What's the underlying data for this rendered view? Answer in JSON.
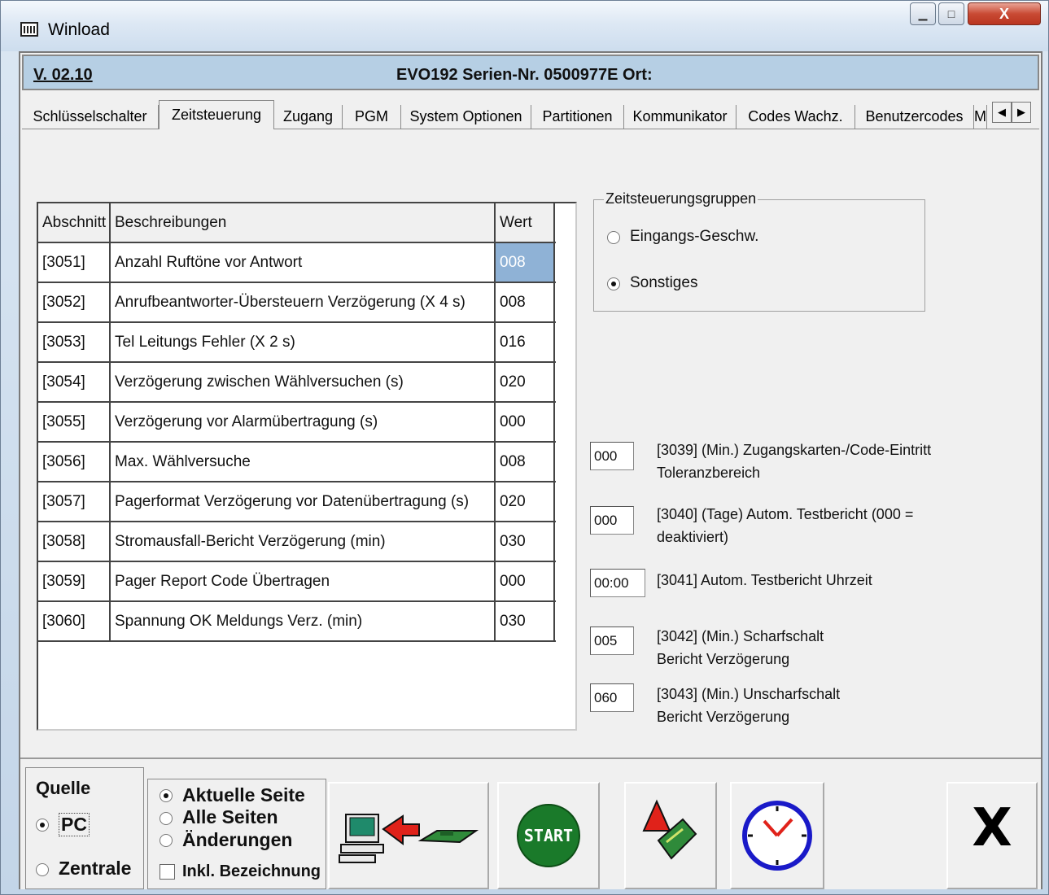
{
  "window": {
    "title": "Winload"
  },
  "header": {
    "version": "V. 02.10",
    "device": "EVO192  Serien-Nr. 0500977E Ort:"
  },
  "tabs": [
    {
      "label": "Schlüsselschalter"
    },
    {
      "label": "Zeitsteuerung"
    },
    {
      "label": "Zugang"
    },
    {
      "label": "PGM"
    },
    {
      "label": "System Optionen"
    },
    {
      "label": "Partitionen"
    },
    {
      "label": "Kommunikator"
    },
    {
      "label": "Codes Wachz."
    },
    {
      "label": "Benutzercodes"
    },
    {
      "label": "M"
    }
  ],
  "table": {
    "headers": [
      "Abschnitt",
      "Beschreibungen",
      "Wert"
    ],
    "rows": [
      {
        "section": "[3051]",
        "description": "Anzahl Ruftöne vor Antwort",
        "value": "008"
      },
      {
        "section": "[3052]",
        "description": "Anrufbeantworter-Übersteuern Verzögerung (X 4 s)",
        "value": "008"
      },
      {
        "section": "[3053]",
        "description": "Tel Leitungs Fehler (X 2 s)",
        "value": "016"
      },
      {
        "section": "[3054]",
        "description": "Verzögerung zwischen Wählversuchen (s)",
        "value": "020"
      },
      {
        "section": "[3055]",
        "description": "Verzögerung vor Alarmübertragung (s)",
        "value": "000"
      },
      {
        "section": "[3056]",
        "description": "Max. Wählversuche",
        "value": "008"
      },
      {
        "section": "[3057]",
        "description": "Pagerformat Verzögerung vor Datenübertragung (s)",
        "value": "020"
      },
      {
        "section": "[3058]",
        "description": "Stromausfall-Bericht Verzögerung (min)",
        "value": "030"
      },
      {
        "section": "[3059]",
        "description": "Pager Report Code Übertragen",
        "value": "000"
      },
      {
        "section": "[3060]",
        "description": "Spannung OK Meldungs Verz. (min)",
        "value": "030"
      }
    ]
  },
  "group": {
    "title": "Zeitsteuerungsgruppen",
    "option1": "Eingangs-Geschw.",
    "option2": "Sonstiges",
    "selected": "Sonstiges"
  },
  "settings": [
    {
      "value": "000",
      "label_line1": "[3039] (Min.) Zugangskarten-/Code-Eintritt",
      "label_line2": "Toleranzbereich"
    },
    {
      "value": "000",
      "label_line1": "[3040] (Tage) Autom. Testbericht (000 =",
      "label_line2": "deaktiviert)"
    },
    {
      "value": "00:00",
      "label_line1": "[3041] Autom. Testbericht Uhrzeit",
      "label_line2": ""
    },
    {
      "value": "005",
      "label_line1": "[3042] (Min.) Scharfschalt",
      "label_line2": "Bericht Verzögerung"
    },
    {
      "value": "060",
      "label_line1": "[3043] (Min.) Unscharfschalt",
      "label_line2": "Bericht Verzögerung"
    }
  ],
  "bottom": {
    "source_title": "Quelle",
    "source_pc": "PC",
    "source_central": "Zentrale",
    "page_current": "Aktuelle Seite",
    "page_all": "Alle Seiten",
    "page_changes": "Änderungen",
    "include_label": "Inkl. Bezeichnung",
    "start_label": "START",
    "close_symbol": "X"
  },
  "colors": {
    "selected_value": "#8fb2d6",
    "start_green": "#1a7a2a",
    "close_red": "#c94a34"
  }
}
